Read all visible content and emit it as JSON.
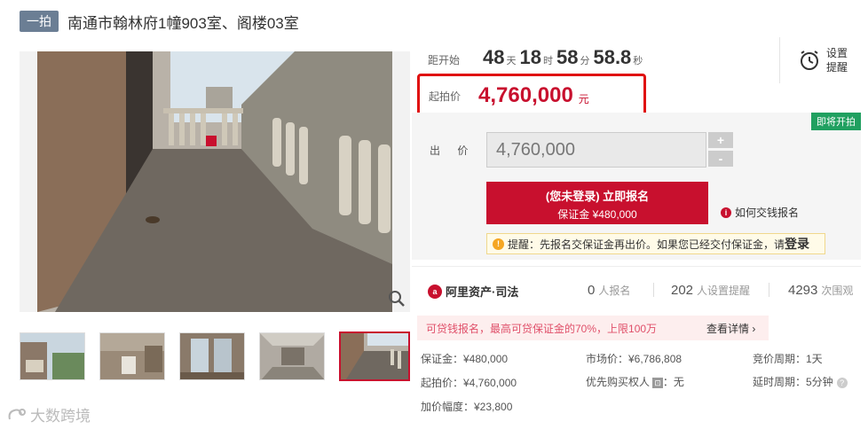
{
  "header": {
    "tag": "一拍",
    "title": "南通市翰林府1幢903室、阁楼03室"
  },
  "countdown": {
    "label": "距开始",
    "days": "48",
    "days_unit": "天",
    "hours": "18",
    "hours_unit": "时",
    "minutes": "58",
    "minutes_unit": "分",
    "seconds": "58.8",
    "seconds_unit": "秒"
  },
  "remind": {
    "line1": "设置",
    "line2": "提醒",
    "icon": "alarm-clock-icon"
  },
  "start_price": {
    "label": "起拍价",
    "value": "4,760,000",
    "unit": "元"
  },
  "status_badge": "即将开拍",
  "bid": {
    "label": "出 价",
    "value": "4,760,000",
    "plus": "+",
    "minus": "-"
  },
  "signup": {
    "main": "(您未登录) 立即报名",
    "sub": "保证金 ¥480,000"
  },
  "how_link": "如何交钱报名",
  "tip": {
    "text": "提醒：先报名交保证金再出价。如果您已经交付保证金，请",
    "link": "登录"
  },
  "platform": {
    "name": "阿里资产·司法"
  },
  "stats": [
    {
      "value": "0",
      "label": "人报名"
    },
    {
      "value": "202",
      "label": "人设置提醒"
    },
    {
      "value": "4293",
      "label": "次围观"
    }
  ],
  "promo": {
    "text": "可贷钱报名，最高可贷保证金的70%，上限100万",
    "link": "查看详情"
  },
  "info": {
    "deposit": "保证金：¥480,000",
    "start_price": "起拍价：¥4,760,000",
    "increment": "加价幅度：¥23,800",
    "market_price": "市场价：¥6,786,808",
    "priority_label": "优先购买权人",
    "priority_badge": "⊡",
    "priority_value": "：无",
    "cycle": "竞价周期：1天",
    "delay": "延时周期：5分钟"
  },
  "watermark": "大数跨境",
  "colors": {
    "accent": "#c8102e",
    "highlight_box": "#e01010",
    "status_green": "#20a060"
  }
}
